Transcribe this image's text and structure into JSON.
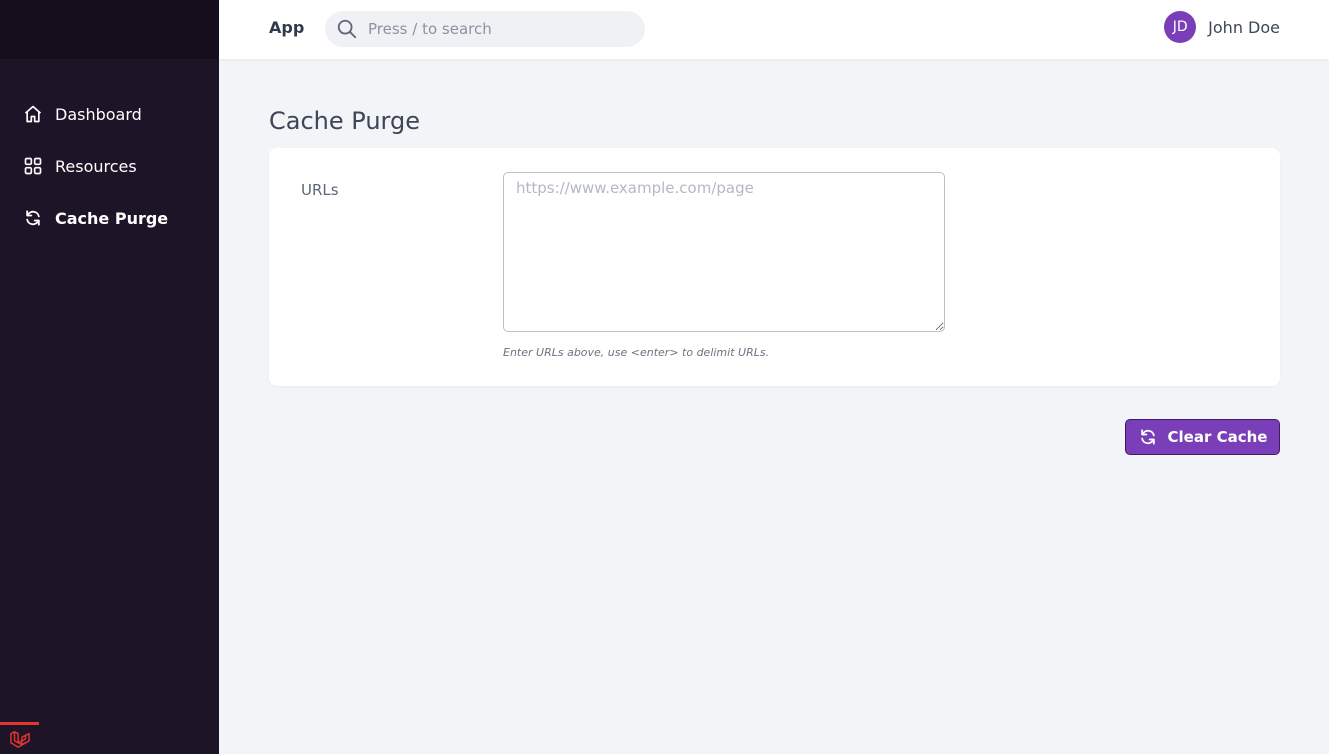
{
  "sidebar": {
    "items": [
      {
        "label": "Dashboard",
        "icon": "home-icon"
      },
      {
        "label": "Resources",
        "icon": "grid-icon"
      },
      {
        "label": "Cache Purge",
        "icon": "refresh-icon",
        "active": true
      }
    ],
    "logo_icon": "laravel-logo-icon"
  },
  "header": {
    "app_label": "App",
    "search_placeholder": "Press / to search",
    "user": {
      "initials": "JD",
      "name": "John Doe"
    }
  },
  "main": {
    "title": "Cache Purge",
    "form": {
      "urls_label": "URLs",
      "urls_value": "",
      "urls_placeholder": "https://www.example.com/page",
      "help_text": "Enter URLs above, use <enter> to delimit URLs."
    },
    "clear_button_label": "Clear Cache"
  },
  "colors": {
    "sidebar_bg": "#1e1428",
    "accent": "#7a3fb8",
    "page_bg": "#f3f4f8",
    "logo_red": "#e3342f"
  }
}
